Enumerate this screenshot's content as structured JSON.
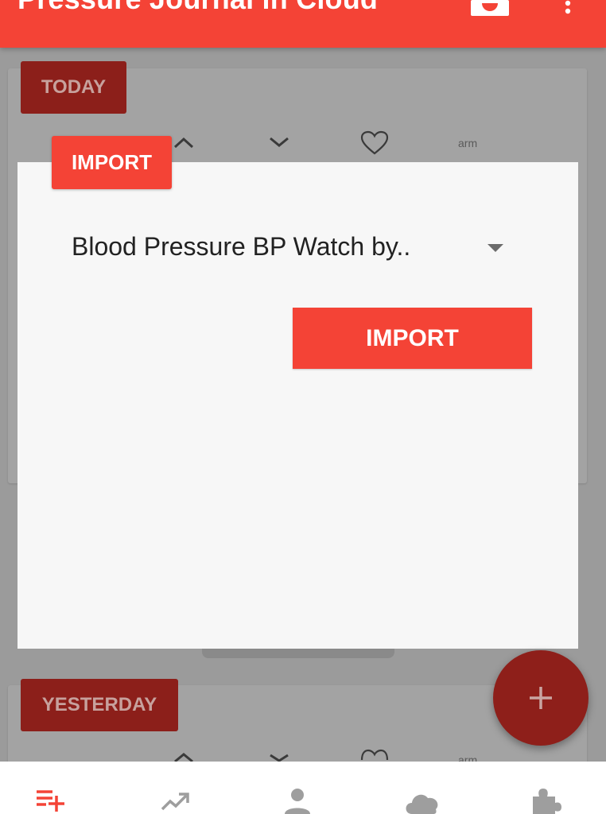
{
  "app": {
    "title": "Pressure Journal in Cloud"
  },
  "toolbar": {
    "cuff_icon": "bp-cuff-icon",
    "menu_icon": "overflow-menu-icon"
  },
  "list": {
    "sections": [
      {
        "label": "TODAY",
        "columns": {
          "systolic_icon": "chevron-up-icon",
          "diastolic_icon": "chevron-down-icon",
          "pulse_icon": "heart-icon",
          "arm_label": "arm"
        }
      },
      {
        "label": "YESTERDAY",
        "columns": {
          "systolic_icon": "chevron-up-icon",
          "diastolic_icon": "chevron-down-icon",
          "pulse_icon": "heart-icon",
          "arm_label": "arm"
        }
      }
    ]
  },
  "dialog": {
    "title": "IMPORT",
    "source_value": "Blood Pressure BP Watch by..",
    "import_button_label": "IMPORT"
  },
  "fab": {
    "icon": "plus-icon"
  },
  "bottom_nav": {
    "items": [
      {
        "icon": "list-add-icon",
        "active": true
      },
      {
        "icon": "trending-up-icon",
        "active": false
      },
      {
        "icon": "person-icon",
        "active": false
      },
      {
        "icon": "cloud-icon",
        "active": false
      },
      {
        "icon": "extension-icon",
        "active": false
      }
    ]
  },
  "colors": {
    "accent": "#f44336",
    "scrim_accent": "#8c1f1a",
    "nav_inactive": "#9e9e9e"
  }
}
